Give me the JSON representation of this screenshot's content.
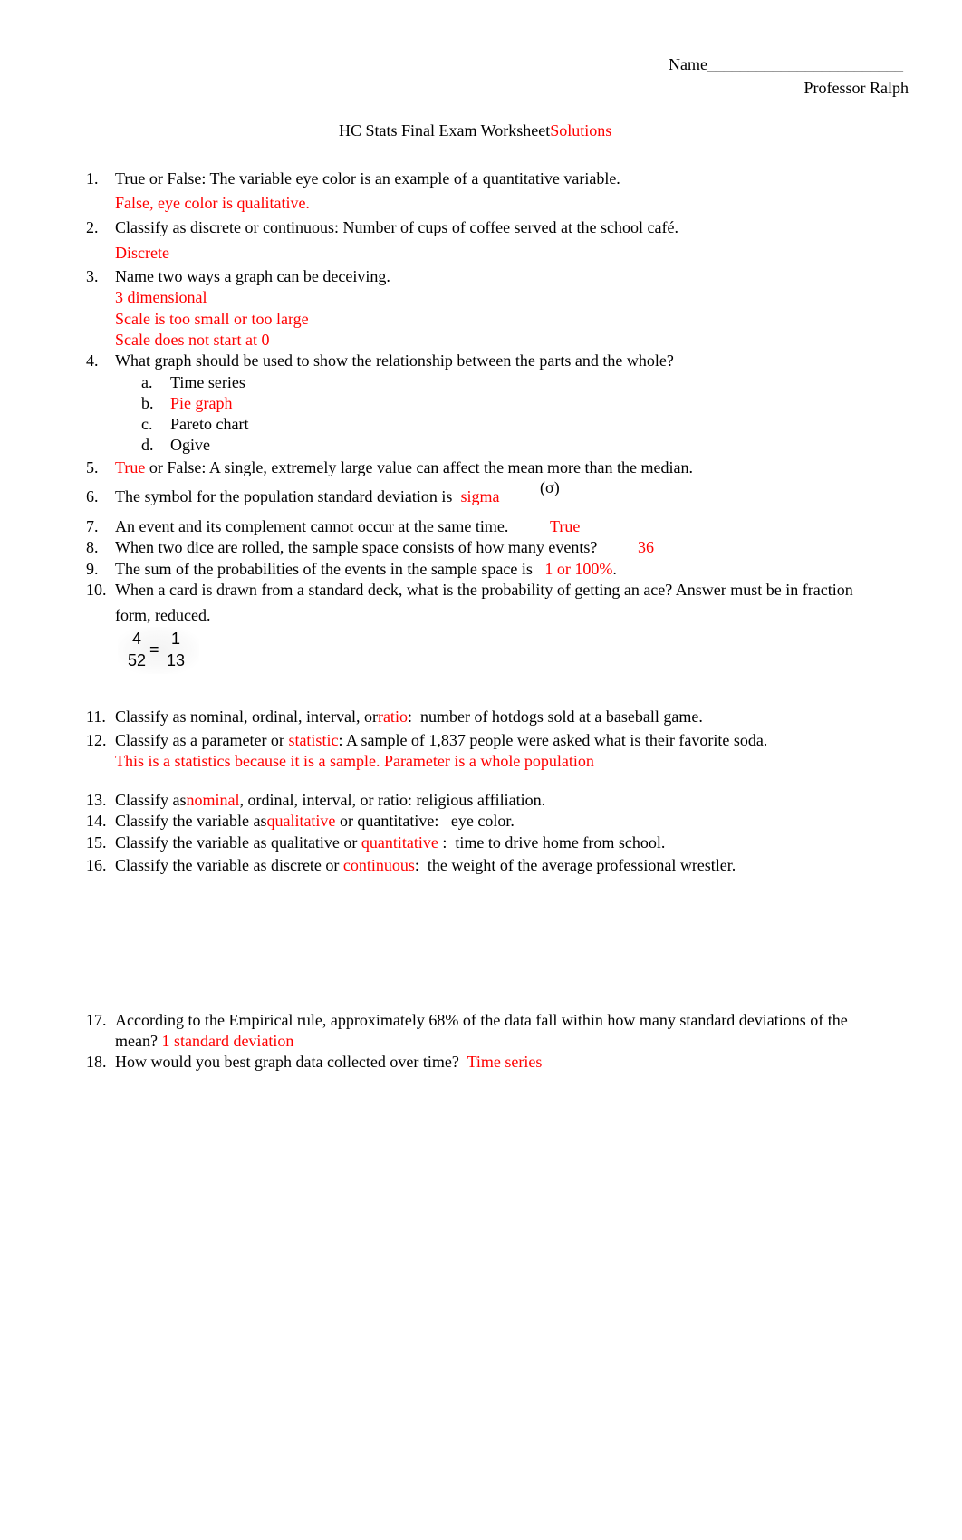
{
  "header": {
    "name_label": "Name",
    "name_blank": "________________________",
    "professor": "Professor Ralph"
  },
  "title": {
    "text": "HC Stats Final Exam Worksheet",
    "highlight": "Solutions"
  },
  "colors": {
    "answer": "#ff0000",
    "text": "#000000"
  },
  "questions": [
    {
      "num": "1.",
      "text": "True or False:  The variable eye color is an example of a quantitative variable.",
      "answer": "False, eye color is qualitative."
    },
    {
      "num": "2.",
      "text": "Classify as discrete or continuous:  Number of cups of coffee served at the school café.",
      "answer": "Discrete"
    },
    {
      "num": "3.",
      "text": "Name two ways a graph can be deceiving.",
      "answers": [
        "3 dimensional",
        "Scale is too small or too large",
        "Scale does not start at 0"
      ]
    },
    {
      "num": "4.",
      "text": "What graph should be used to show the relationship between the parts and the whole?",
      "options": [
        {
          "letter": "a.",
          "text": "Time series",
          "correct": false
        },
        {
          "letter": "b.",
          "text": "Pie graph",
          "correct": true
        },
        {
          "letter": "c.",
          "text": "Pareto chart",
          "correct": false
        },
        {
          "letter": "d.",
          "text": "Ogive",
          "correct": false
        }
      ]
    },
    {
      "num": "5.",
      "answer": "True",
      "text": " or False:  A single, extremely large value can affect the mean more than the median."
    },
    {
      "num": "6.",
      "text": "The symbol for the population standard deviation is ",
      "answer": "sigma",
      "symbol": "(σ)"
    },
    {
      "num": "7.",
      "text": "An event and its complement cannot occur at the same time.",
      "answer": "True"
    },
    {
      "num": "8.",
      "text": "When two dice are rolled, the sample space consists of how many events?",
      "answer": "36"
    },
    {
      "num": "9.",
      "text": "The sum of the probabilities of the events in the sample space is ",
      "answer": "1 or 100%",
      "suffix": "."
    },
    {
      "num": "10.",
      "text": "When a card is drawn from a standard deck, what is the probability of getting an ace? Answer must be in fraction",
      "text_cont": "form, reduced.",
      "fraction": {
        "num1": "4",
        "den1": "52",
        "eq": "=",
        "num2": "1",
        "den2": "13"
      }
    },
    {
      "num": "11.",
      "text": "Classify as nominal, ordinal, interval, or",
      "answer": "ratio",
      "suffix": ":  number of hotdogs sold at a baseball game."
    },
    {
      "num": "12.",
      "text": "Classify as a parameter or ",
      "answer": "statistic",
      "suffix": ": A sample of 1,837 people were asked what is their favorite soda.",
      "explanation": "This is a statistics because it is a sample.  Parameter is a whole population"
    },
    {
      "num": "13.",
      "text": "Classify as",
      "answer": "nominal",
      "suffix": ", ordinal, interval, or ratio: religious affiliation."
    },
    {
      "num": "14.",
      "text": "Classify the variable as",
      "answer": "qualitative",
      "suffix": " or quantitative:   eye color."
    },
    {
      "num": "15.",
      "text": "Classify the variable as qualitative or ",
      "answer": "quantitative",
      "suffix": " :  time to drive home from school."
    },
    {
      "num": "16.",
      "text": "Classify the variable as discrete or ",
      "answer": "continuous",
      "suffix": ":  the weight of the average professional wrestler."
    },
    {
      "num": "17.",
      "text": "According to the Empirical rule, approximately 68% of the data fall within how many standard deviations of the",
      "text_cont": "mean? ",
      "answer": "1 standard deviation"
    },
    {
      "num": "18.",
      "text": "How would you best graph data collected over time?  ",
      "answer": "Time series"
    }
  ]
}
